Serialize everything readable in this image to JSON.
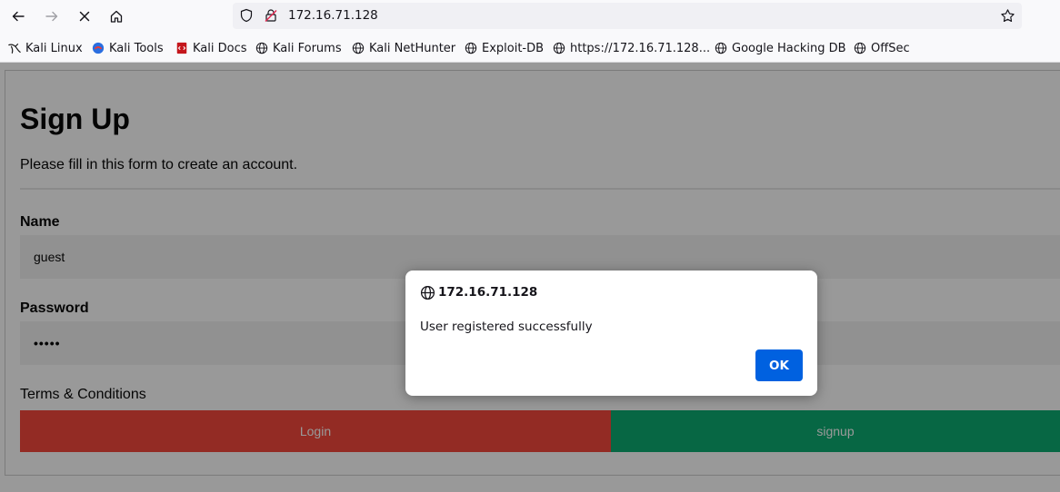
{
  "browser": {
    "url": "172.16.71.128",
    "bookmarks": [
      {
        "label": "Kali Linux",
        "icon": "kali-dragon-icon"
      },
      {
        "label": "Kali Tools",
        "icon": "kali-tools-icon"
      },
      {
        "label": "Kali Docs",
        "icon": "kali-docs-icon"
      },
      {
        "label": "Kali Forums",
        "icon": "globe-icon"
      },
      {
        "label": "Kali NetHunter",
        "icon": "globe-icon"
      },
      {
        "label": "Exploit-DB",
        "icon": "globe-icon"
      },
      {
        "label": "https://172.16.71.128...",
        "icon": "globe-icon"
      },
      {
        "label": "Google Hacking DB",
        "icon": "globe-icon"
      },
      {
        "label": "OffSec",
        "icon": "globe-icon"
      }
    ]
  },
  "form": {
    "title": "Sign Up",
    "subtitle": "Please fill in this form to create an account.",
    "name_label": "Name",
    "name_value": "guest",
    "password_label": "Password",
    "password_value": "•••••",
    "terms": "Terms & Conditions",
    "login_label": "Login",
    "signup_label": "signup",
    "colors": {
      "login": "#f44336",
      "signup": "#04AA6D"
    }
  },
  "dialog": {
    "origin": "172.16.71.128",
    "message": "User registered successfully",
    "ok_label": "OK",
    "ok_color": "#0061e0"
  }
}
